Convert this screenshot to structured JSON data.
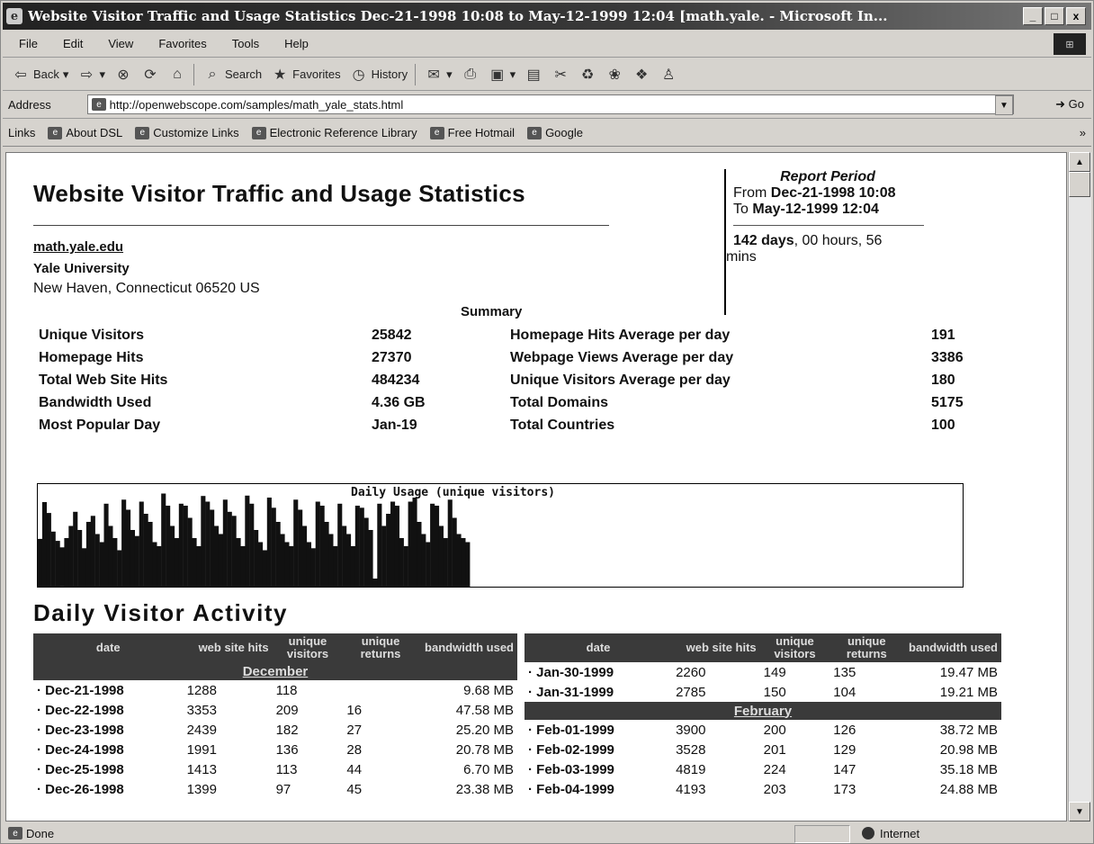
{
  "window": {
    "title": "Website Visitor Traffic and Usage Statistics Dec-21-1998 10:08 to May-12-1999 12:04 [math.yale. - Microsoft In...",
    "min": "_",
    "max": "□",
    "close": "x"
  },
  "menu": [
    "File",
    "Edit",
    "View",
    "Favorites",
    "Tools",
    "Help"
  ],
  "toolbar": {
    "back": "Back",
    "search": "Search",
    "favorites": "Favorites",
    "history": "History"
  },
  "address": {
    "label": "Address",
    "url": "http://openwebscope.com/samples/math_yale_stats.html",
    "go": "Go"
  },
  "links": {
    "label": "Links",
    "items": [
      "About DSL",
      "Customize Links",
      "Electronic Reference Library",
      "Free Hotmail",
      "Google"
    ]
  },
  "status": {
    "text": "Done",
    "zone": "Internet"
  },
  "page": {
    "title": "Website Visitor Traffic and Usage Statistics",
    "site": "math.yale.edu",
    "org": "Yale University",
    "address": "New Haven, Connecticut 06520 US",
    "period": {
      "heading": "Report Period",
      "from_label": "From",
      "from": "Dec-21-1998 10:08",
      "to_label": "To",
      "to": "May-12-1999 12:04",
      "days": "142 days",
      "rest": ", 00 hours, 56",
      "mins": "mins"
    },
    "summary_heading": "Summary",
    "summary_left": [
      {
        "label": "Unique Visitors",
        "value": "25842"
      },
      {
        "label": "Homepage Hits",
        "value": "27370"
      },
      {
        "label": "Total Web Site Hits",
        "value": "484234"
      },
      {
        "label": "Bandwidth Used",
        "value": "4.36 GB"
      },
      {
        "label": "Most Popular Day",
        "value": "Jan-19"
      }
    ],
    "summary_right": [
      {
        "label": "Homepage Hits Average per day",
        "value": "191"
      },
      {
        "label": "Webpage Views Average per day",
        "value": "3386"
      },
      {
        "label": "Unique Visitors Average per day",
        "value": "180"
      },
      {
        "label": "Total Domains",
        "value": "5175"
      },
      {
        "label": "Total Countries",
        "value": "100"
      }
    ],
    "chart_title": "Daily Usage (unique visitors)",
    "activity_title": "Daily Visitor Activity",
    "columns": [
      "date",
      "web site hits",
      "unique visitors",
      "unique returns",
      "bandwidth used"
    ],
    "left_table": {
      "month": "December",
      "rows": [
        [
          "· Dec-21-1998",
          "1288",
          "118",
          "",
          "9.68 MB"
        ],
        [
          "· Dec-22-1998",
          "3353",
          "209",
          "16",
          "47.58 MB"
        ],
        [
          "· Dec-23-1998",
          "2439",
          "182",
          "27",
          "25.20 MB"
        ],
        [
          "· Dec-24-1998",
          "1991",
          "136",
          "28",
          "20.78 MB"
        ],
        [
          "· Dec-25-1998",
          "1413",
          "113",
          "44",
          "6.70 MB"
        ],
        [
          "· Dec-26-1998",
          "1399",
          "97",
          "45",
          "23.38 MB"
        ]
      ]
    },
    "right_table": {
      "rows_before": [
        [
          "· Jan-30-1999",
          "2260",
          "149",
          "135",
          "19.47 MB"
        ],
        [
          "· Jan-31-1999",
          "2785",
          "150",
          "104",
          "19.21 MB"
        ]
      ],
      "month": "February",
      "rows_after": [
        [
          "· Feb-01-1999",
          "3900",
          "200",
          "126",
          "38.72 MB"
        ],
        [
          "· Feb-02-1999",
          "3528",
          "201",
          "129",
          "20.98 MB"
        ],
        [
          "· Feb-03-1999",
          "4819",
          "224",
          "147",
          "35.18 MB"
        ],
        [
          "· Feb-04-1999",
          "4193",
          "203",
          "173",
          "24.88 MB"
        ]
      ]
    }
  },
  "chart_data": {
    "type": "bar",
    "title": "Daily Usage (unique visitors)",
    "xlabel": "",
    "ylabel": "",
    "values": [
      118,
      209,
      182,
      136,
      113,
      97,
      120,
      150,
      185,
      140,
      95,
      160,
      175,
      130,
      110,
      205,
      150,
      120,
      90,
      215,
      190,
      140,
      125,
      210,
      180,
      160,
      110,
      100,
      230,
      200,
      150,
      120,
      205,
      200,
      170,
      120,
      100,
      224,
      210,
      190,
      150,
      130,
      215,
      185,
      175,
      120,
      100,
      225,
      205,
      140,
      110,
      90,
      220,
      195,
      160,
      130,
      110,
      100,
      215,
      190,
      150,
      110,
      95,
      210,
      200,
      160,
      130,
      100,
      205,
      150,
      130,
      100,
      200,
      195,
      170,
      140,
      20,
      205,
      150,
      180,
      210,
      200,
      120,
      100,
      210,
      220,
      160,
      130,
      110,
      205,
      200,
      150,
      120,
      215,
      170,
      130,
      120,
      110
    ],
    "ylim": [
      0,
      240
    ]
  }
}
